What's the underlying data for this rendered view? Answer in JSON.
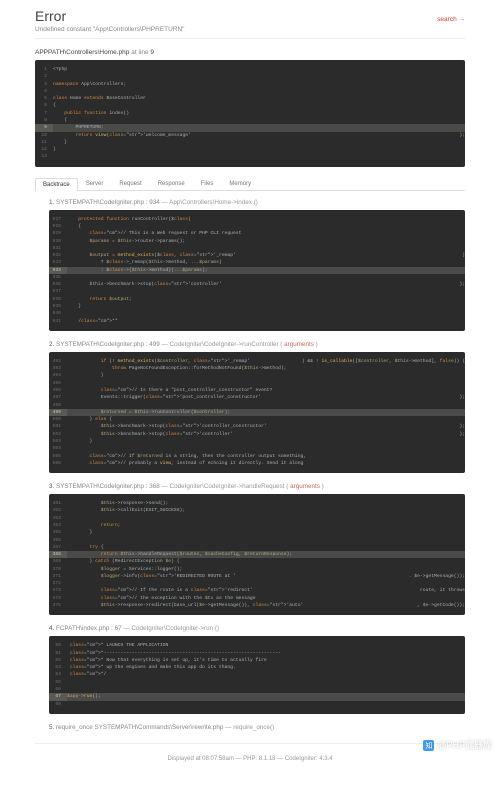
{
  "header": {
    "title": "Error",
    "subtitle": "Undefined constant \"App\\Controllers\\PHPRETURN\"",
    "search_label": "search →"
  },
  "source": {
    "path_prefix": "APPPATH\\Controllers\\Home.php",
    "at_line": " at line ",
    "line_num": "9"
  },
  "code_main": [
    {
      "n": "1",
      "t": "<?php"
    },
    {
      "n": "2",
      "t": ""
    },
    {
      "n": "3",
      "t": "namespace App\\Controllers;"
    },
    {
      "n": "4",
      "t": ""
    },
    {
      "n": "5",
      "t": "class Home extends BaseController"
    },
    {
      "n": "6",
      "t": "{"
    },
    {
      "n": "7",
      "t": "    public function index()"
    },
    {
      "n": "8",
      "t": "    {"
    },
    {
      "n": "9",
      "t": "        PHPRETURN;",
      "hl": true
    },
    {
      "n": "10",
      "t": "        return view('welcome_message');"
    },
    {
      "n": "11",
      "t": "    }"
    },
    {
      "n": "12",
      "t": "}"
    },
    {
      "n": "13",
      "t": ""
    }
  ],
  "tabs": [
    "Backtrace",
    "Server",
    "Request",
    "Response",
    "Files",
    "Memory"
  ],
  "bt": [
    {
      "title_num": "1.",
      "title_path": "SYSTEMPATH\\CodeIgniter.php : 934",
      "title_meth": " —  App\\Controllers\\Home->index ()",
      "lines": [
        {
          "n": "927",
          "t": "    protected function runController($class)"
        },
        {
          "n": "928",
          "t": "    {"
        },
        {
          "n": "929",
          "t": "        // This is a Web request or PHP CLI request"
        },
        {
          "n": "930",
          "t": "        $params = $this->router->params();"
        },
        {
          "n": "931",
          "t": ""
        },
        {
          "n": "932",
          "t": "        $output = method_exists($class, '_remap')"
        },
        {
          "n": "933",
          "t": "            ? $class->_remap($this->method, ...$params)"
        },
        {
          "n": "934",
          "t": "            : $class->{$this->method}(...$params);",
          "hl": true
        },
        {
          "n": "935",
          "t": ""
        },
        {
          "n": "936",
          "t": "        $this->benchmark->stop('controller');"
        },
        {
          "n": "937",
          "t": ""
        },
        {
          "n": "938",
          "t": "        return $output;"
        },
        {
          "n": "939",
          "t": "    }"
        },
        {
          "n": "940",
          "t": ""
        },
        {
          "n": "941",
          "t": "    /**"
        }
      ]
    },
    {
      "title_num": "2.",
      "title_path": "SYSTEMPATH\\CodeIgniter.php : 499",
      "title_meth": " —  CodeIgniter\\CodeIgniter->runController ( ",
      "args": "arguments",
      "close": " )",
      "lines": [
        {
          "n": "492",
          "t": "            if (! method_exists($controller, '_remap') && ! is_callable([$controller, $this->method], false)) {"
        },
        {
          "n": "493",
          "t": "                throw PageNotFoundException::forMethodNotFound($this->method);"
        },
        {
          "n": "494",
          "t": "            }"
        },
        {
          "n": "495",
          "t": ""
        },
        {
          "n": "496",
          "t": "            // Is there a \"post_controller_constructor\" event?"
        },
        {
          "n": "497",
          "t": "            Events::trigger('post_controller_constructor');"
        },
        {
          "n": "498",
          "t": ""
        },
        {
          "n": "499",
          "t": "            $returned = $this->runController($controller);",
          "hl": true
        },
        {
          "n": "500",
          "t": "        } else {"
        },
        {
          "n": "501",
          "t": "            $this->benchmark->stop('controller_constructor');"
        },
        {
          "n": "502",
          "t": "            $this->benchmark->stop('controller');"
        },
        {
          "n": "503",
          "t": "        }"
        },
        {
          "n": "504",
          "t": ""
        },
        {
          "n": "505",
          "t": "        // If $returned is a string, then the controller output something,"
        },
        {
          "n": "506",
          "t": "        // probably a view, instead of echoing it directly. Send it along"
        }
      ]
    },
    {
      "title_num": "3.",
      "title_path": "SYSTEMPATH\\CodeIgniter.php : 368",
      "title_meth": " —  CodeIgniter\\CodeIgniter->handleRequest ( ",
      "args": "arguments",
      "close": " )",
      "lines": [
        {
          "n": "361",
          "t": "            $this->response->send();"
        },
        {
          "n": "362",
          "t": "            $this->callExit(EXIT_SUCCESS);"
        },
        {
          "n": "363",
          "t": ""
        },
        {
          "n": "364",
          "t": "            return;"
        },
        {
          "n": "365",
          "t": "        }"
        },
        {
          "n": "366",
          "t": ""
        },
        {
          "n": "367",
          "t": "        try {"
        },
        {
          "n": "368",
          "t": "            return $this->handleRequest($routes, $cacheConfig, $returnResponse);",
          "hl": true
        },
        {
          "n": "369",
          "t": "        } catch (RedirectException $e) {"
        },
        {
          "n": "370",
          "t": "            $logger = Services::logger();"
        },
        {
          "n": "371",
          "t": "            $logger->info('REDIRECTED ROUTE at ' . $e->getMessage());"
        },
        {
          "n": "372",
          "t": ""
        },
        {
          "n": "373",
          "t": "            // If the route is a 'redirect' route, it throws"
        },
        {
          "n": "374",
          "t": "            // the exception with the $to as the message"
        },
        {
          "n": "375",
          "t": "            $this->response->redirect(base_url($e->getMessage()), 'auto', $e->getCode());"
        }
      ]
    },
    {
      "title_num": "4.",
      "title_path": "FCPATH\\index.php : 67",
      "title_meth": " —  CodeIgniter\\CodeIgniter->run ()",
      "lines": [
        {
          "n": "60",
          "t": " * LAUNCH THE APPLICATION"
        },
        {
          "n": "61",
          "t": " *---------------------------------------------------------------"
        },
        {
          "n": "62",
          "t": " * Now that everything is set up, it's time to actually fire"
        },
        {
          "n": "63",
          "t": " * up the engines and make this app do its thang."
        },
        {
          "n": "64",
          "t": " */"
        },
        {
          "n": "65",
          "t": ""
        },
        {
          "n": "66",
          "t": ""
        },
        {
          "n": "67",
          "t": "$app->run();",
          "hl": true
        },
        {
          "n": "68",
          "t": ""
        }
      ]
    },
    {
      "title_num": "5.",
      "title_path": "require_once SYSTEMPATH\\Commands\\Server\\rewrite.php",
      "title_meth": " —  require_once()"
    }
  ],
  "footer": "Displayed at 08:07:58am — PHP: 8.1.18  —  CodeIgniter: 4.3.4",
  "watermark": {
    "icon": "知",
    "text": "@PHP武器库"
  }
}
